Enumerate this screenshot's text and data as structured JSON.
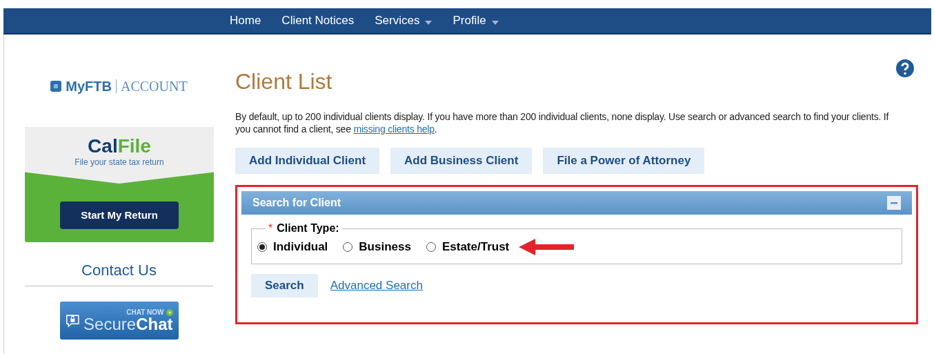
{
  "nav": [
    {
      "label": "Home",
      "dropdown": false
    },
    {
      "label": "Client Notices",
      "dropdown": false
    },
    {
      "label": "Services",
      "dropdown": true
    },
    {
      "label": "Profile",
      "dropdown": true
    }
  ],
  "sidebar": {
    "logo": {
      "brand": "MyFTB",
      "suffix": "ACCOUNT"
    },
    "calfile": {
      "logo": [
        "Cal",
        "File"
      ],
      "tagline": "File your state tax return",
      "button": "Start My Return"
    },
    "contact": "Contact Us",
    "chat": {
      "top": "CHAT NOW",
      "main": [
        "Secure",
        "Chat"
      ]
    }
  },
  "title": "Client List",
  "intro": {
    "text": "By default, up to 200 individual clients display. If you have more than 200 individual clients, none display. Use search or advanced search to find your clients. If you cannot find a client, see ",
    "link": "missing clients help",
    "end": "."
  },
  "actions": [
    "Add Individual Client",
    "Add Business Client",
    "File a Power of Attorney"
  ],
  "search_panel": {
    "title": "Search for Client",
    "expanded": true,
    "legend": {
      "required": "*",
      "label": "Client Type:"
    },
    "options": [
      {
        "label": "Individual",
        "selected": true
      },
      {
        "label": "Business",
        "selected": false
      },
      {
        "label": "Estate/Trust",
        "selected": false
      }
    ],
    "search_button": "Search",
    "advanced_link": "Advanced Search"
  }
}
